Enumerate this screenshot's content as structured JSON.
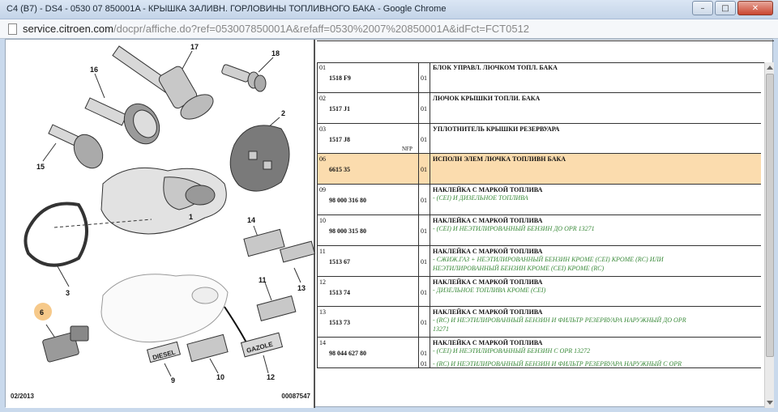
{
  "window": {
    "title": "C4 (B7) - DS4 - 0530 07 850001A - КРЫШКА ЗАЛИВН. ГОРЛОВИНЫ ТОПЛИВНОГО БАКА - Google Chrome",
    "minimize": "–",
    "maximize": "□",
    "close": "✕"
  },
  "address": {
    "host": "service.citroen.com",
    "path": "/docpr/affiche.do?ref=053007850001A&refaff=0530%2007%20850001A&idFct=FCT0512"
  },
  "diagram": {
    "date": "02/2013",
    "code": "00087547",
    "callouts": [
      "17",
      "18",
      "16",
      "2",
      "15",
      "1",
      "14",
      "3",
      "13",
      "11",
      "6",
      "9",
      "10",
      "12"
    ],
    "labels": {
      "diesel": "DIESEL",
      "gazole": "GAZOLE"
    },
    "highlighted_callout": "6"
  },
  "parts": [
    {
      "num": "01",
      "ref": "1518 F9",
      "nfp": "",
      "qty": "01",
      "title": "БЛОК УПРАВЛ. ЛЮЧКОМ ТОПЛ. БАКА",
      "notes": [],
      "highlight": false
    },
    {
      "num": "02",
      "ref": "1517 J1",
      "nfp": "",
      "qty": "01",
      "title": "ЛЮЧОК КРЫШКИ ТОПЛИ. БАКА",
      "notes": [],
      "highlight": false
    },
    {
      "num": "03",
      "ref": "1517 J8",
      "nfp": "NFP",
      "qty": "01",
      "title": "УПЛОТНИТЕЛЬ КРЫШКИ РЕЗЕРВУАРА",
      "notes": [],
      "highlight": false
    },
    {
      "num": "06",
      "ref": "6615 35",
      "nfp": "",
      "qty": "01",
      "title": "ИСПОЛН ЭЛЕМ ЛЮЧКА ТОПЛИВН БАКА",
      "notes": [],
      "highlight": true
    },
    {
      "num": "09",
      "ref": "98 000 316 80",
      "nfp": "",
      "qty": "01",
      "title": "НАКЛЕЙКА С МАРКОЙ ТОПЛИВА",
      "notes": [
        "- (CEI) И ДИЗЕЛЬНОЕ ТОПЛИВА"
      ],
      "highlight": false
    },
    {
      "num": "10",
      "ref": "98 000 315 80",
      "nfp": "",
      "qty": "01",
      "title": "НАКЛЕЙКА С МАРКОЙ ТОПЛИВА",
      "notes": [
        "- (CEI) И НЕЭТИЛИРОВАННЫЙ БЕНЗИН ДО OPR 13271"
      ],
      "highlight": false
    },
    {
      "num": "11",
      "ref": "1513 67",
      "nfp": "",
      "qty": "01",
      "title": "НАКЛЕЙКА С МАРКОЙ ТОПЛИВА",
      "notes": [
        "- СЖИЖ.ГАЗ + НЕЭТИЛИРОВАННЫЙ БЕНЗИН КРОМЕ (CEI) КРОМЕ (RC) ИЛИ",
        "НЕЭТИЛИРОВАННЫЙ БЕНЗИН КРОМЕ (CEI) КРОМЕ (RC)"
      ],
      "highlight": false
    },
    {
      "num": "12",
      "ref": "1513 74",
      "nfp": "",
      "qty": "01",
      "title": "НАКЛЕЙКА С МАРКОЙ ТОПЛИВА",
      "notes": [
        "- ДИЗЕЛЬНОЕ ТОПЛИВА КРОМЕ (CEI)"
      ],
      "highlight": false
    },
    {
      "num": "13",
      "ref": "1513 73",
      "nfp": "",
      "qty": "01",
      "title": "НАКЛЕЙКА С МАРКОЙ ТОПЛИВА",
      "notes": [
        "- (RC) И НЕЭТИЛИРОВАННЫЙ БЕНЗИН И ФИЛЬТР РЕЗЕРВУАРА НАРУЖНЫЙ ДО OPR",
        "13271"
      ],
      "highlight": false
    },
    {
      "num": "14",
      "ref": "98 044 627 80",
      "nfp": "",
      "qty": "01",
      "title": "НАКЛЕЙКА С МАРКОЙ ТОПЛИВА",
      "notes": [
        "- (CEI) И НЕЭТИЛИРОВАННЫЙ БЕНЗИН С OPR 13272"
      ],
      "qty2": "01",
      "note2": "- (RC) И НЕЭТИЛИРОВАННЫЙ БЕНЗИН И ФИЛЬТР РЕЗЕРВУАРА НАРУЖНЫЙ С OPR",
      "highlight": false
    }
  ]
}
